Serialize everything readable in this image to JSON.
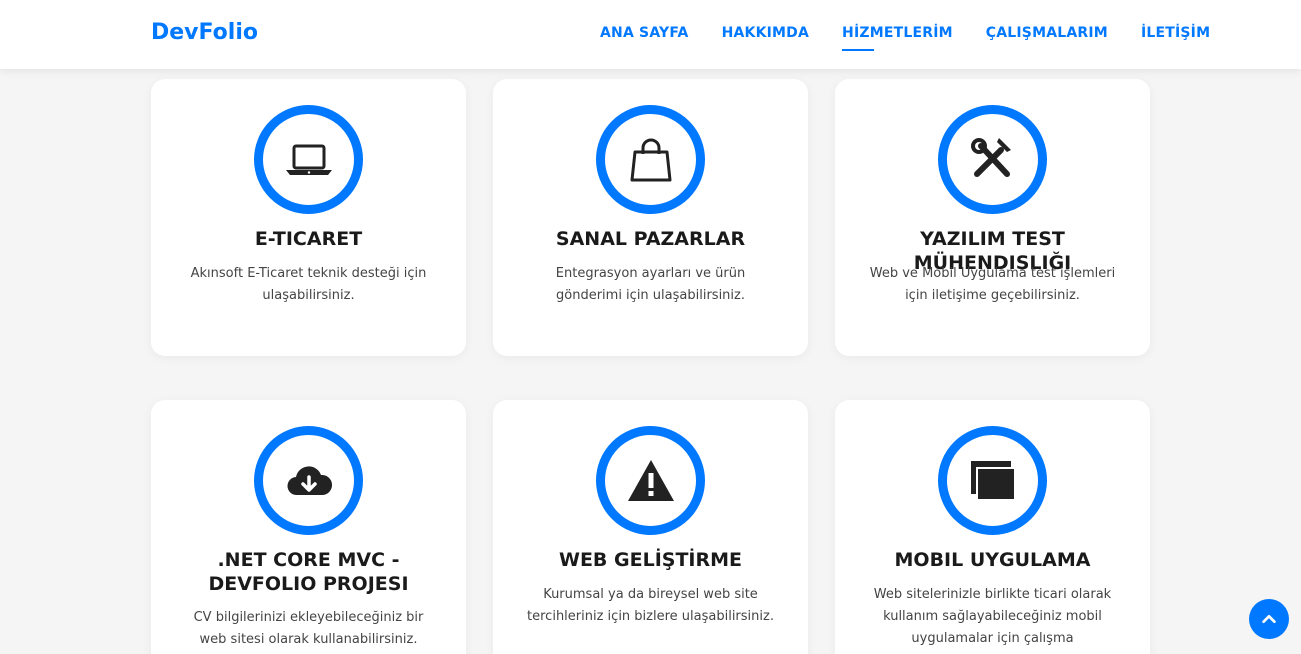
{
  "brand": "DevFolio",
  "nav": [
    "ANA SAYFA",
    "HAKKIMDA",
    "HİZMETLERİM",
    "ÇALIŞMALARIM",
    "İLETİŞİM"
  ],
  "active_nav": "HİZMETLERİM",
  "services": [
    {
      "icon": "laptop-icon",
      "title": "E-TICARET",
      "desc": "Akınsoft E-Ticaret teknik desteği için ulaşabilirsiniz."
    },
    {
      "icon": "shopping-bag-icon",
      "title": "SANAL PAZARLAR",
      "desc": "Entegrasyon ayarları ve ürün gönderimi için ulaşabilirsiniz."
    },
    {
      "icon": "tools-icon",
      "title": "YAZILIM TEST MÜHENDISLIĞI",
      "desc": "Web ve Mobil Uygulama test işlemleri için iletişime geçebilirsiniz."
    },
    {
      "icon": "cloud-download-icon",
      "title": ".NET CORE MVC - DEVFOLIO PROJESI",
      "desc": "CV bilgilerinizi ekleyebileceğiniz bir web sitesi olarak kullanabilirsiniz."
    },
    {
      "icon": "warning-icon",
      "title": "WEB GELİŞTİRME",
      "desc": "Kurumsal ya da bireysel web site tercihleriniz için bizlere ulaşabilirsiniz."
    },
    {
      "icon": "windows-stack-icon",
      "title": "MOBIL UYGULAMA",
      "desc": "Web sitelerinizle birlikte ticari olarak kullanım sağlayabileceğiniz mobil uygulamalar için çalışma yapılabilmektedir."
    }
  ],
  "colors": {
    "accent": "#0078ff",
    "background": "#f5f5f5",
    "card": "#ffffff"
  }
}
